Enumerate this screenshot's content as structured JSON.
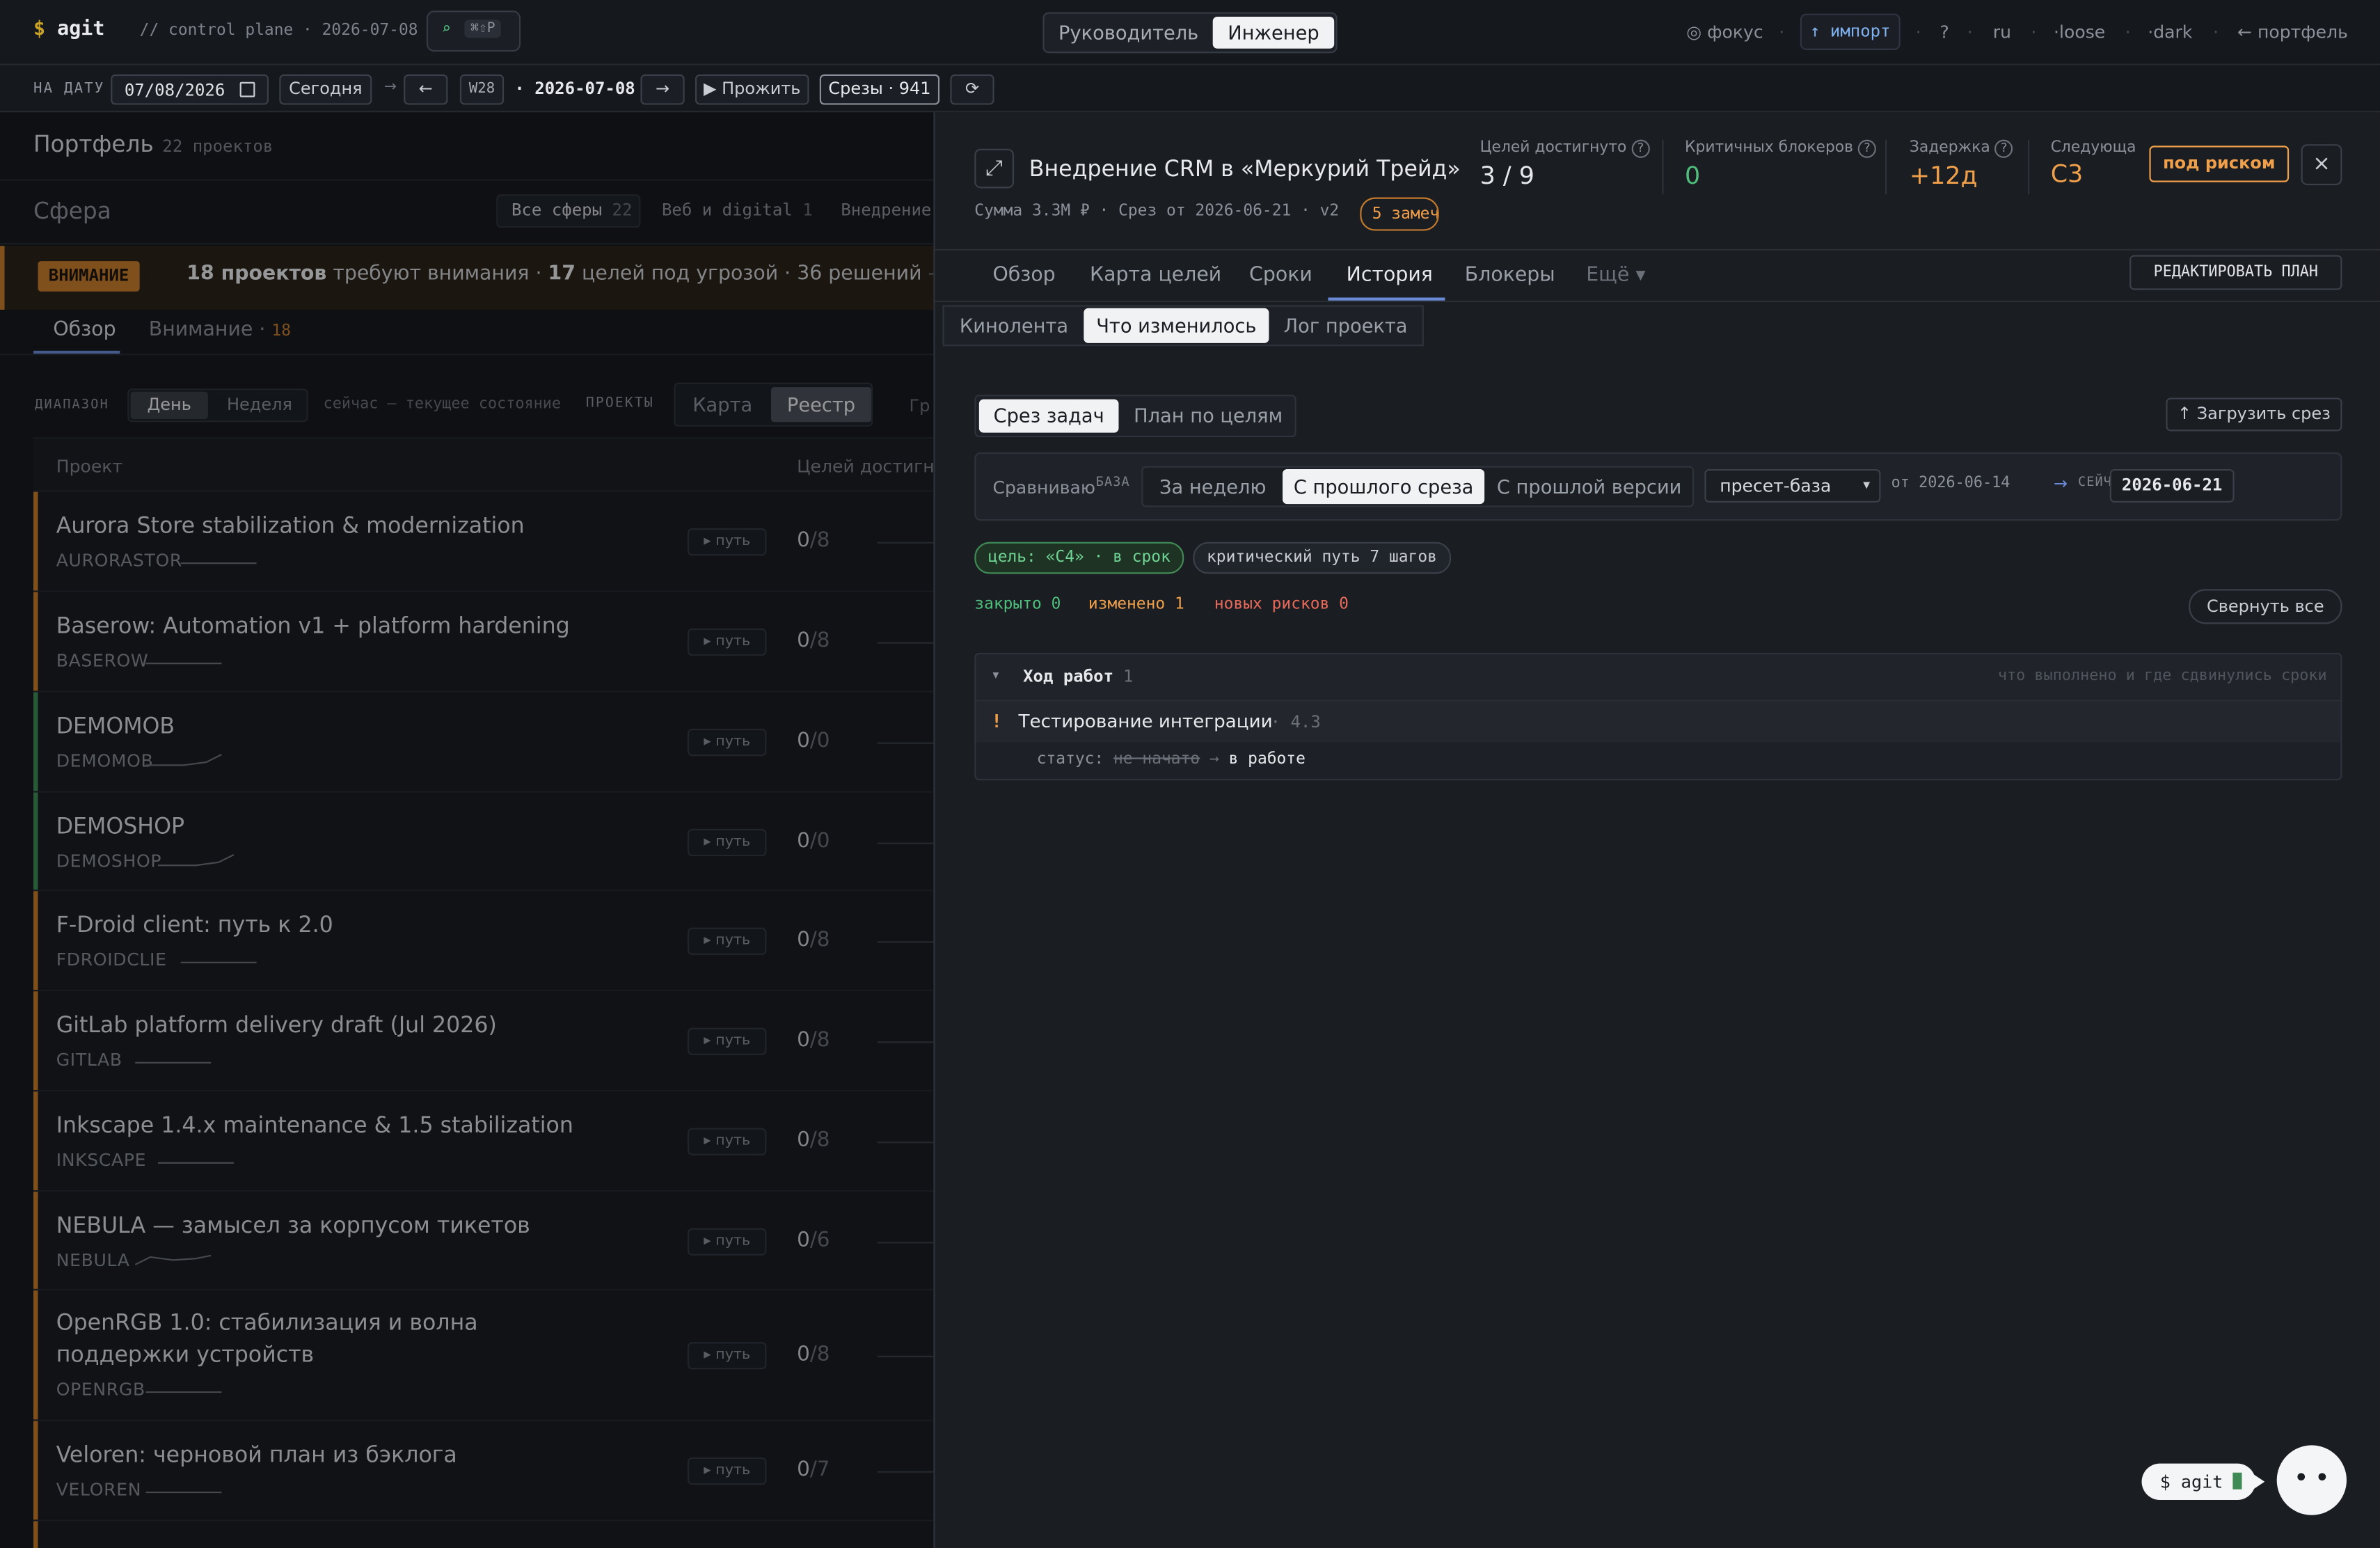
{
  "topbar": {
    "dollar": "$",
    "app": "agit",
    "control_plane": "// control plane · 2026-07-08",
    "search_glyph": "⌕",
    "search_kbd": "⌘⇧P",
    "roles": [
      "Руководитель",
      "Инженер"
    ],
    "focus": "◎ фокус",
    "import": "↑ импорт",
    "help": "?",
    "lang": "ru",
    "density": "·loose",
    "theme": "·dark",
    "portfolio_link": "← портфель",
    "dot": "·"
  },
  "datebar": {
    "label": "НА ДАТУ",
    "date_value": "07/08/2026",
    "today": "Сегодня",
    "arrow": "→",
    "prev": "←",
    "week": "W28",
    "date_bold": "· 2026-07-08",
    "next": "→",
    "play": "▶ Прожить",
    "slices": "Срезы · 941",
    "refresh": "⟳"
  },
  "left": {
    "portfolio_title": "Портфель",
    "portfolio_count": "22 проектов",
    "sphere_title": "Сфера",
    "sphere_filters": [
      {
        "label": "Все сферы",
        "count": "22"
      },
      {
        "label": "Веб и digital",
        "count": "1"
      },
      {
        "label": "Внедрение",
        "count": ""
      }
    ],
    "attention_badge": "ВНИМАНИЕ",
    "attention_strong1": "18 проектов",
    "attention_text1": "требуют внимания ·",
    "attention_strong2": "17",
    "attention_text2": "целей под угрозой · 36 решений",
    "attention_tail": "— А",
    "tabs": [
      {
        "label": "Обзор"
      },
      {
        "label": "Внимание ·",
        "count": "18"
      }
    ],
    "range_label": "ДИАПАЗОН",
    "range_options": [
      "День",
      "Неделя"
    ],
    "range_note": "сейчас — текущее состояние",
    "projects_label": "ПРОЕКТЫ",
    "view_options": [
      "Карта",
      "Реестр"
    ],
    "group_label": "Гр",
    "col_project": "Проект",
    "col_goals": "Целей достигну",
    "projects": [
      {
        "title": "Aurora Store stabilization & modernization",
        "code": "AURORASTOR",
        "path": "▸ путь",
        "done": "0",
        "total": "/8",
        "color": "orange"
      },
      {
        "title": "Baserow: Automation v1 + platform hardening",
        "code": "BASEROW",
        "path": "▸ путь",
        "done": "0",
        "total": "/8",
        "color": "orange"
      },
      {
        "title": "DEMOMOB",
        "code": "DEMOMOB",
        "path": "▸ путь",
        "done": "0",
        "total": "/0",
        "color": "green"
      },
      {
        "title": "DEMOSHOP",
        "code": "DEMOSHOP",
        "path": "▸ путь",
        "done": "0",
        "total": "/0",
        "color": "green"
      },
      {
        "title": "F-Droid client: путь к 2.0",
        "code": "FDROIDCLIE",
        "path": "▸ путь",
        "done": "0",
        "total": "/8",
        "color": "orange"
      },
      {
        "title": "GitLab platform delivery draft (Jul 2026)",
        "code": "GITLAB",
        "path": "▸ путь",
        "done": "0",
        "total": "/8",
        "color": "orange"
      },
      {
        "title": "Inkscape 1.4.x maintenance & 1.5 stabilization",
        "code": "INKSCAPE",
        "path": "▸ путь",
        "done": "0",
        "total": "/8",
        "color": "orange"
      },
      {
        "title": "NEBULA — замысел за корпусом тикетов",
        "code": "NEBULA",
        "path": "▸ путь",
        "done": "0",
        "total": "/6",
        "color": "orange"
      },
      {
        "title": "OpenRGB 1.0: стабилизация и волна поддержки устройств",
        "code": "OPENRGB",
        "path": "▸ путь",
        "done": "0",
        "total": "/8",
        "color": "orange"
      },
      {
        "title": "Veloren: черновой план из бэклога",
        "code": "VELOREN",
        "path": "▸ путь",
        "done": "0",
        "total": "/7",
        "color": "orange"
      }
    ]
  },
  "panel": {
    "expand_icon": "⤢",
    "title": "Внедрение CRM в «Меркурий Трейд»",
    "meta": "Сумма 3.3M ₽ · Срез от 2026-06-21 · v2",
    "notes_badge": "5 замеч",
    "kpis": [
      {
        "label": "Целей достигнуто",
        "help": "?",
        "value": "3 / 9",
        "color": "#e6e8eb"
      },
      {
        "label": "Критичных блокеров",
        "help": "?",
        "value": "0",
        "color": "#4fbf7b"
      },
      {
        "label": "Задержка",
        "help": "?",
        "value": "+12д",
        "color": "#f0a04b"
      },
      {
        "label": "Следующа",
        "help": "",
        "value": "C3",
        "color": "#f0a04b"
      }
    ],
    "risk_badge": "под риском",
    "close": "×",
    "tabs": [
      "Обзор",
      "Карта целей",
      "Сроки",
      "История",
      "Блокеры",
      "Ещё ▾"
    ],
    "edit_plan": "РЕДАКТИРОВАТЬ ПЛАН",
    "subtabs": [
      "Кинолента",
      "Что изменилось",
      "Лог проекта"
    ],
    "mode_tabs": [
      "Срез задач",
      "План по целям"
    ],
    "upload": "↑ Загрузить срез",
    "compare": {
      "label": "Сравниваю",
      "base_label": "БАЗА",
      "options": [
        "За неделю",
        "С прошлого среза",
        "С прошлой версии"
      ],
      "preset": "пресет-база",
      "from": "от 2026-06-14",
      "arrow": "→",
      "now_label": "СЕЙЧАС",
      "now_date": "2026-06-21"
    },
    "chips": {
      "goal": "цель: «C4» · в срок",
      "critical": "критический путь 7 шагов"
    },
    "summary": {
      "closed": "закрыто 0",
      "changed": "изменено 1",
      "risks": "новых рисков 0",
      "collapse": "Свернуть все"
    },
    "section": {
      "toggle": "▾",
      "title": "Ход работ",
      "count": "1",
      "hint": "что выполнено и где сдвинулись сроки",
      "item_mark": "!",
      "item_title": "Тестирование интеграции",
      "item_id": "· 4.3",
      "status_label": "статус:",
      "status_old": "не начато",
      "status_arrow": "→",
      "status_new": "в работе"
    }
  },
  "assistant": {
    "prompt": "$ agit",
    "face": "• •"
  }
}
